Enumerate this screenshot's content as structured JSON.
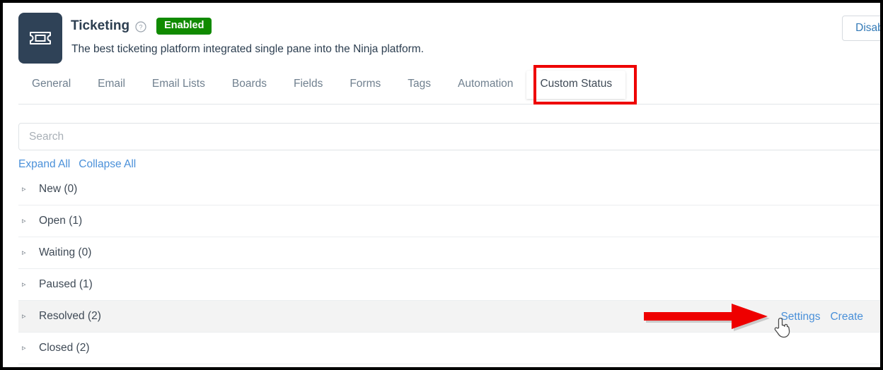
{
  "app": {
    "icon_name": "ticket-icon",
    "title": "Ticketing",
    "help_icon": "help-circle-icon",
    "status_badge": "Enabled",
    "status_badge_color": "#108a00",
    "subtitle": "The best ticketing platform integrated single pane into the Ninja platform.",
    "disable_button": "Disable"
  },
  "tabs": [
    {
      "label": "General",
      "active": false
    },
    {
      "label": "Email",
      "active": false
    },
    {
      "label": "Email Lists",
      "active": false
    },
    {
      "label": "Boards",
      "active": false
    },
    {
      "label": "Fields",
      "active": false
    },
    {
      "label": "Forms",
      "active": false
    },
    {
      "label": "Tags",
      "active": false
    },
    {
      "label": "Automation",
      "active": false
    },
    {
      "label": "Custom Status",
      "active": true
    }
  ],
  "search": {
    "placeholder": "Search",
    "value": ""
  },
  "bulk_actions": {
    "expand_all": "Expand All",
    "collapse_all": "Collapse All"
  },
  "status_list": {
    "caret_glyph": "▹",
    "rows": [
      {
        "label": "New (0)",
        "highlighted": false,
        "actions": []
      },
      {
        "label": "Open (1)",
        "highlighted": false,
        "actions": []
      },
      {
        "label": "Waiting (0)",
        "highlighted": false,
        "actions": []
      },
      {
        "label": "Paused (1)",
        "highlighted": false,
        "actions": []
      },
      {
        "label": "Resolved (2)",
        "highlighted": true,
        "actions": [
          "Settings",
          "Create"
        ]
      },
      {
        "label": "Closed (2)",
        "highlighted": false,
        "actions": []
      }
    ]
  },
  "annotations": {
    "highlight_box_color": "#ee0000",
    "arrow_color": "#ee0000",
    "highlight_target": "Custom Status",
    "arrow_target": "Settings",
    "cursor_icon": "pointer-hand-cursor"
  },
  "colors": {
    "accent_link": "#4a90d9",
    "icon_background": "#2f4257",
    "row_highlight": "#f3f3f3",
    "text_primary": "#3f4a56",
    "tab_inactive": "#70808f"
  }
}
